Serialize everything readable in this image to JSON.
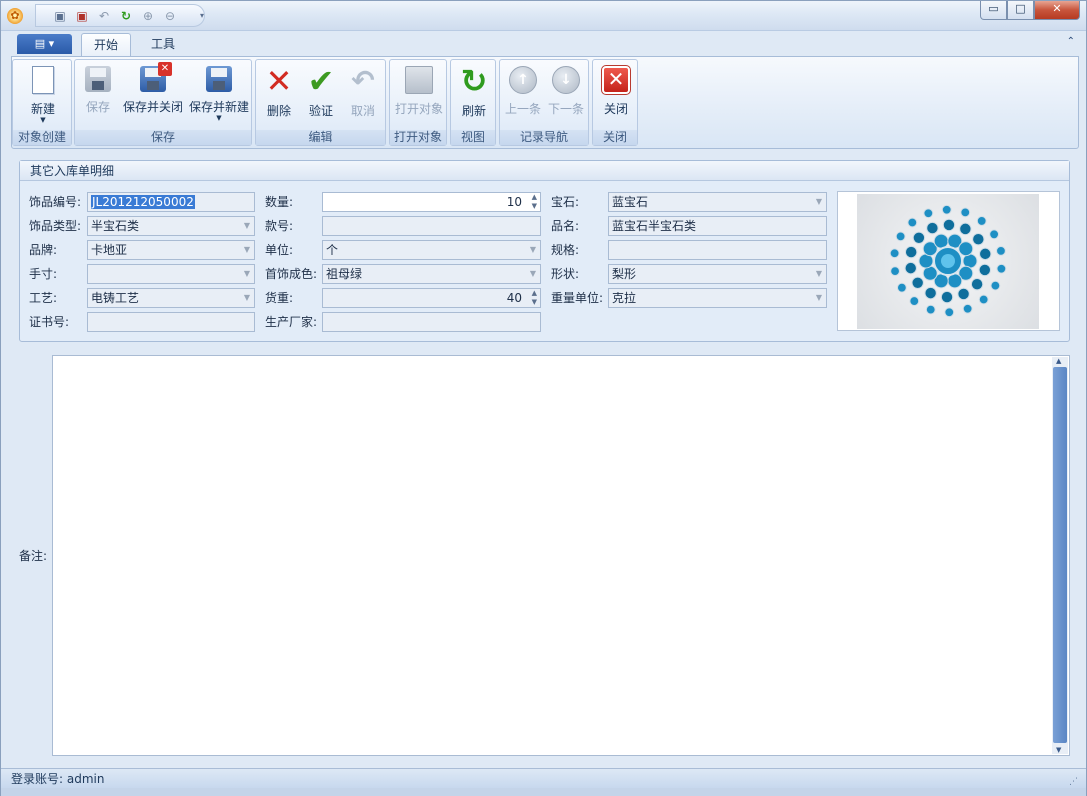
{
  "titlebar": {
    "qat_icons": [
      "save-icon",
      "save-close-icon",
      "undo-icon",
      "refresh-icon",
      "up-icon",
      "down-icon",
      "customize-icon"
    ],
    "controls": {
      "minimize": "▭",
      "maximize": "□",
      "close": "✕"
    }
  },
  "ribbon": {
    "tabs": [
      {
        "label": "开始",
        "active": true
      },
      {
        "label": "工具",
        "active": false
      }
    ],
    "groups": {
      "create": {
        "label": "对象创建",
        "new": "新建"
      },
      "save": {
        "label": "保存",
        "save": "保存",
        "save_close": "保存并关闭",
        "save_new": "保存并新建"
      },
      "edit": {
        "label": "编辑",
        "delete": "删除",
        "validate": "验证",
        "cancel": "取消"
      },
      "open": {
        "label": "打开对象",
        "open_object": "打开对象"
      },
      "view": {
        "label": "视图",
        "refresh": "刷新"
      },
      "nav": {
        "label": "记录导航",
        "prev": "上一条",
        "next": "下一条"
      },
      "close": {
        "label": "关闭",
        "close": "关闭"
      }
    }
  },
  "panel": {
    "title": "其它入库单明细",
    "fields": {
      "item_code": {
        "label": "饰品编号:",
        "value": "JL201212050002"
      },
      "item_type": {
        "label": "饰品类型:",
        "value": "半宝石类"
      },
      "brand": {
        "label": "品牌:",
        "value": "卡地亚"
      },
      "size": {
        "label": "手寸:",
        "value": ""
      },
      "craft": {
        "label": "工艺:",
        "value": "电铸工艺"
      },
      "cert_no": {
        "label": "证书号:",
        "value": ""
      },
      "quantity": {
        "label": "数量:",
        "value": "10"
      },
      "model_no": {
        "label": "款号:",
        "value": ""
      },
      "unit": {
        "label": "单位:",
        "value": "个"
      },
      "jewelry_color": {
        "label": "首饰成色:",
        "value": "祖母绿"
      },
      "goods_weight": {
        "label": "货重:",
        "value": "40"
      },
      "manufacturer": {
        "label": "生产厂家:",
        "value": ""
      },
      "gemstone": {
        "label": "宝石:",
        "value": "蓝宝石"
      },
      "product_name": {
        "label": "品名:",
        "value": "蓝宝石半宝石类"
      },
      "spec": {
        "label": "规格:",
        "value": ""
      },
      "shape": {
        "label": "形状:",
        "value": "梨形"
      },
      "weight_unit": {
        "label": "重量单位:",
        "value": "克拉"
      }
    }
  },
  "remark": {
    "label": "备注:",
    "value": ""
  },
  "status": {
    "text": "登录账号: admin"
  },
  "colors": {
    "accent": "#2a5aa8",
    "selection": "#3a7bd5",
    "gem": "#1e8fc4"
  }
}
